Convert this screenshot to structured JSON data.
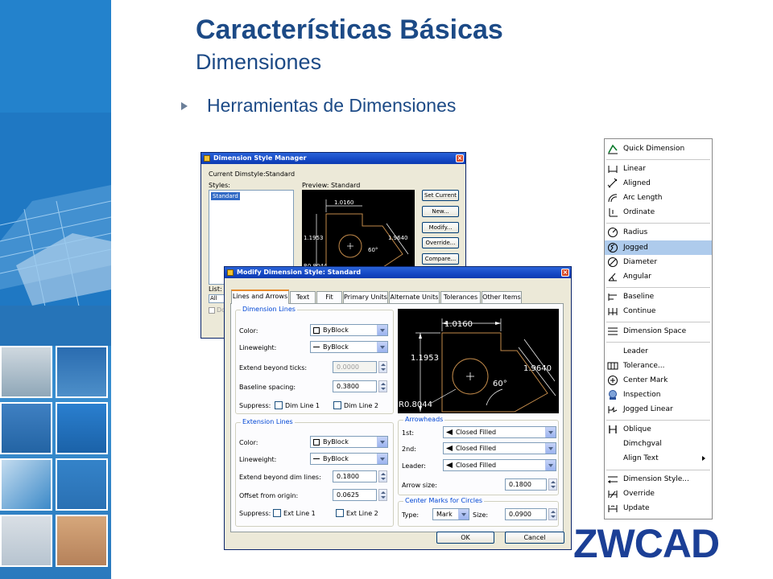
{
  "slide": {
    "title": "Características Básicas",
    "subtitle": "Dimensiones",
    "bullet": "Herramientas de Dimensiones"
  },
  "colors": {
    "title": "#1c4a86",
    "strip": "#1f7cc6",
    "logo": "#1b3f96",
    "selection": "#aecbec",
    "tab_accent": "#e68b2c"
  },
  "dsm": {
    "title": "Dimension Style Manager",
    "current": "Current Dimstyle:Standard",
    "styles_label": "Styles:",
    "style_selected": "Standard",
    "preview_label": "Preview: Standard",
    "list_label": "List:",
    "list_value": "All sty",
    "dont_list": "Do",
    "buttons": [
      "Set Current",
      "New...",
      "Modify...",
      "Override...",
      "Compare..."
    ]
  },
  "preview_dims": {
    "top": "1.0160",
    "left": "1.1953",
    "diag": "1.9640",
    "angle": "60°",
    "radius": "R0.8044"
  },
  "mds": {
    "title": "Modify Dimension Style: Standard",
    "tabs": [
      "Lines and Arrows",
      "Text",
      "Fit",
      "Primary Units",
      "Alternate Units",
      "Tolerances",
      "Other Items"
    ],
    "dim_lines": {
      "group": "Dimension Lines",
      "color_label": "Color:",
      "color_value": "ByBlock",
      "lineweight_label": "Lineweight:",
      "lineweight_value": "ByBlock",
      "extend_label": "Extend beyond ticks:",
      "extend_value": "0.0000",
      "baseline_label": "Baseline spacing:",
      "baseline_value": "0.3800",
      "suppress_label": "Suppress:",
      "suppress_1": "Dim Line 1",
      "suppress_2": "Dim Line 2"
    },
    "ext_lines": {
      "group": "Extension Lines",
      "color_label": "Color:",
      "color_value": "ByBlock",
      "lineweight_label": "Lineweight:",
      "lineweight_value": "ByBlock",
      "extend_label": "Extend beyond dim lines:",
      "extend_value": "0.1800",
      "offset_label": "Offset from origin:",
      "offset_value": "0.0625",
      "suppress_label": "Suppress:",
      "suppress_1": "Ext Line 1",
      "suppress_2": "Ext Line 2"
    },
    "arrowheads": {
      "group": "Arrowheads",
      "first_label": "1st:",
      "first_value": "Closed Filled",
      "second_label": "2nd:",
      "second_value": "Closed Filled",
      "leader_label": "Leader:",
      "leader_value": "Closed Filled",
      "size_label": "Arrow size:",
      "size_value": "0.1800"
    },
    "center_marks": {
      "group": "Center Marks for Circles",
      "type_label": "Type:",
      "type_value": "Mark",
      "size_label": "Size:",
      "size_value": "0.0900"
    },
    "ok": "OK",
    "cancel": "Cancel"
  },
  "menu": {
    "items": [
      {
        "label": "Quick Dimension",
        "icon": "quick-dimension-icon"
      },
      {
        "label": "Linear",
        "icon": "linear-icon"
      },
      {
        "label": "Aligned",
        "icon": "aligned-icon"
      },
      {
        "label": "Arc Length",
        "icon": "arc-length-icon"
      },
      {
        "label": "Ordinate",
        "icon": "ordinate-icon"
      },
      {
        "label": "Radius",
        "icon": "radius-icon"
      },
      {
        "label": "Jogged",
        "icon": "jogged-icon"
      },
      {
        "label": "Diameter",
        "icon": "diameter-icon"
      },
      {
        "label": "Angular",
        "icon": "angular-icon"
      },
      {
        "label": "Baseline",
        "icon": "baseline-icon"
      },
      {
        "label": "Continue",
        "icon": "continue-icon"
      },
      {
        "label": "Dimension Space",
        "icon": "dimension-space-icon"
      },
      {
        "label": "Leader",
        "icon": ""
      },
      {
        "label": "Tolerance...",
        "icon": "tolerance-icon"
      },
      {
        "label": "Center Mark",
        "icon": "center-mark-icon"
      },
      {
        "label": "Inspection",
        "icon": "inspection-icon"
      },
      {
        "label": "Jogged Linear",
        "icon": "jogged-linear-icon"
      },
      {
        "label": "Oblique",
        "icon": "oblique-icon"
      },
      {
        "label": "Dimchgval",
        "icon": ""
      },
      {
        "label": "Align Text",
        "icon": ""
      },
      {
        "label": "Dimension Style...",
        "icon": "dimension-style-icon"
      },
      {
        "label": "Override",
        "icon": "override-icon"
      },
      {
        "label": "Update",
        "icon": "update-icon"
      }
    ],
    "selected": "Jogged"
  },
  "logo": {
    "text": "ZWCAD"
  }
}
